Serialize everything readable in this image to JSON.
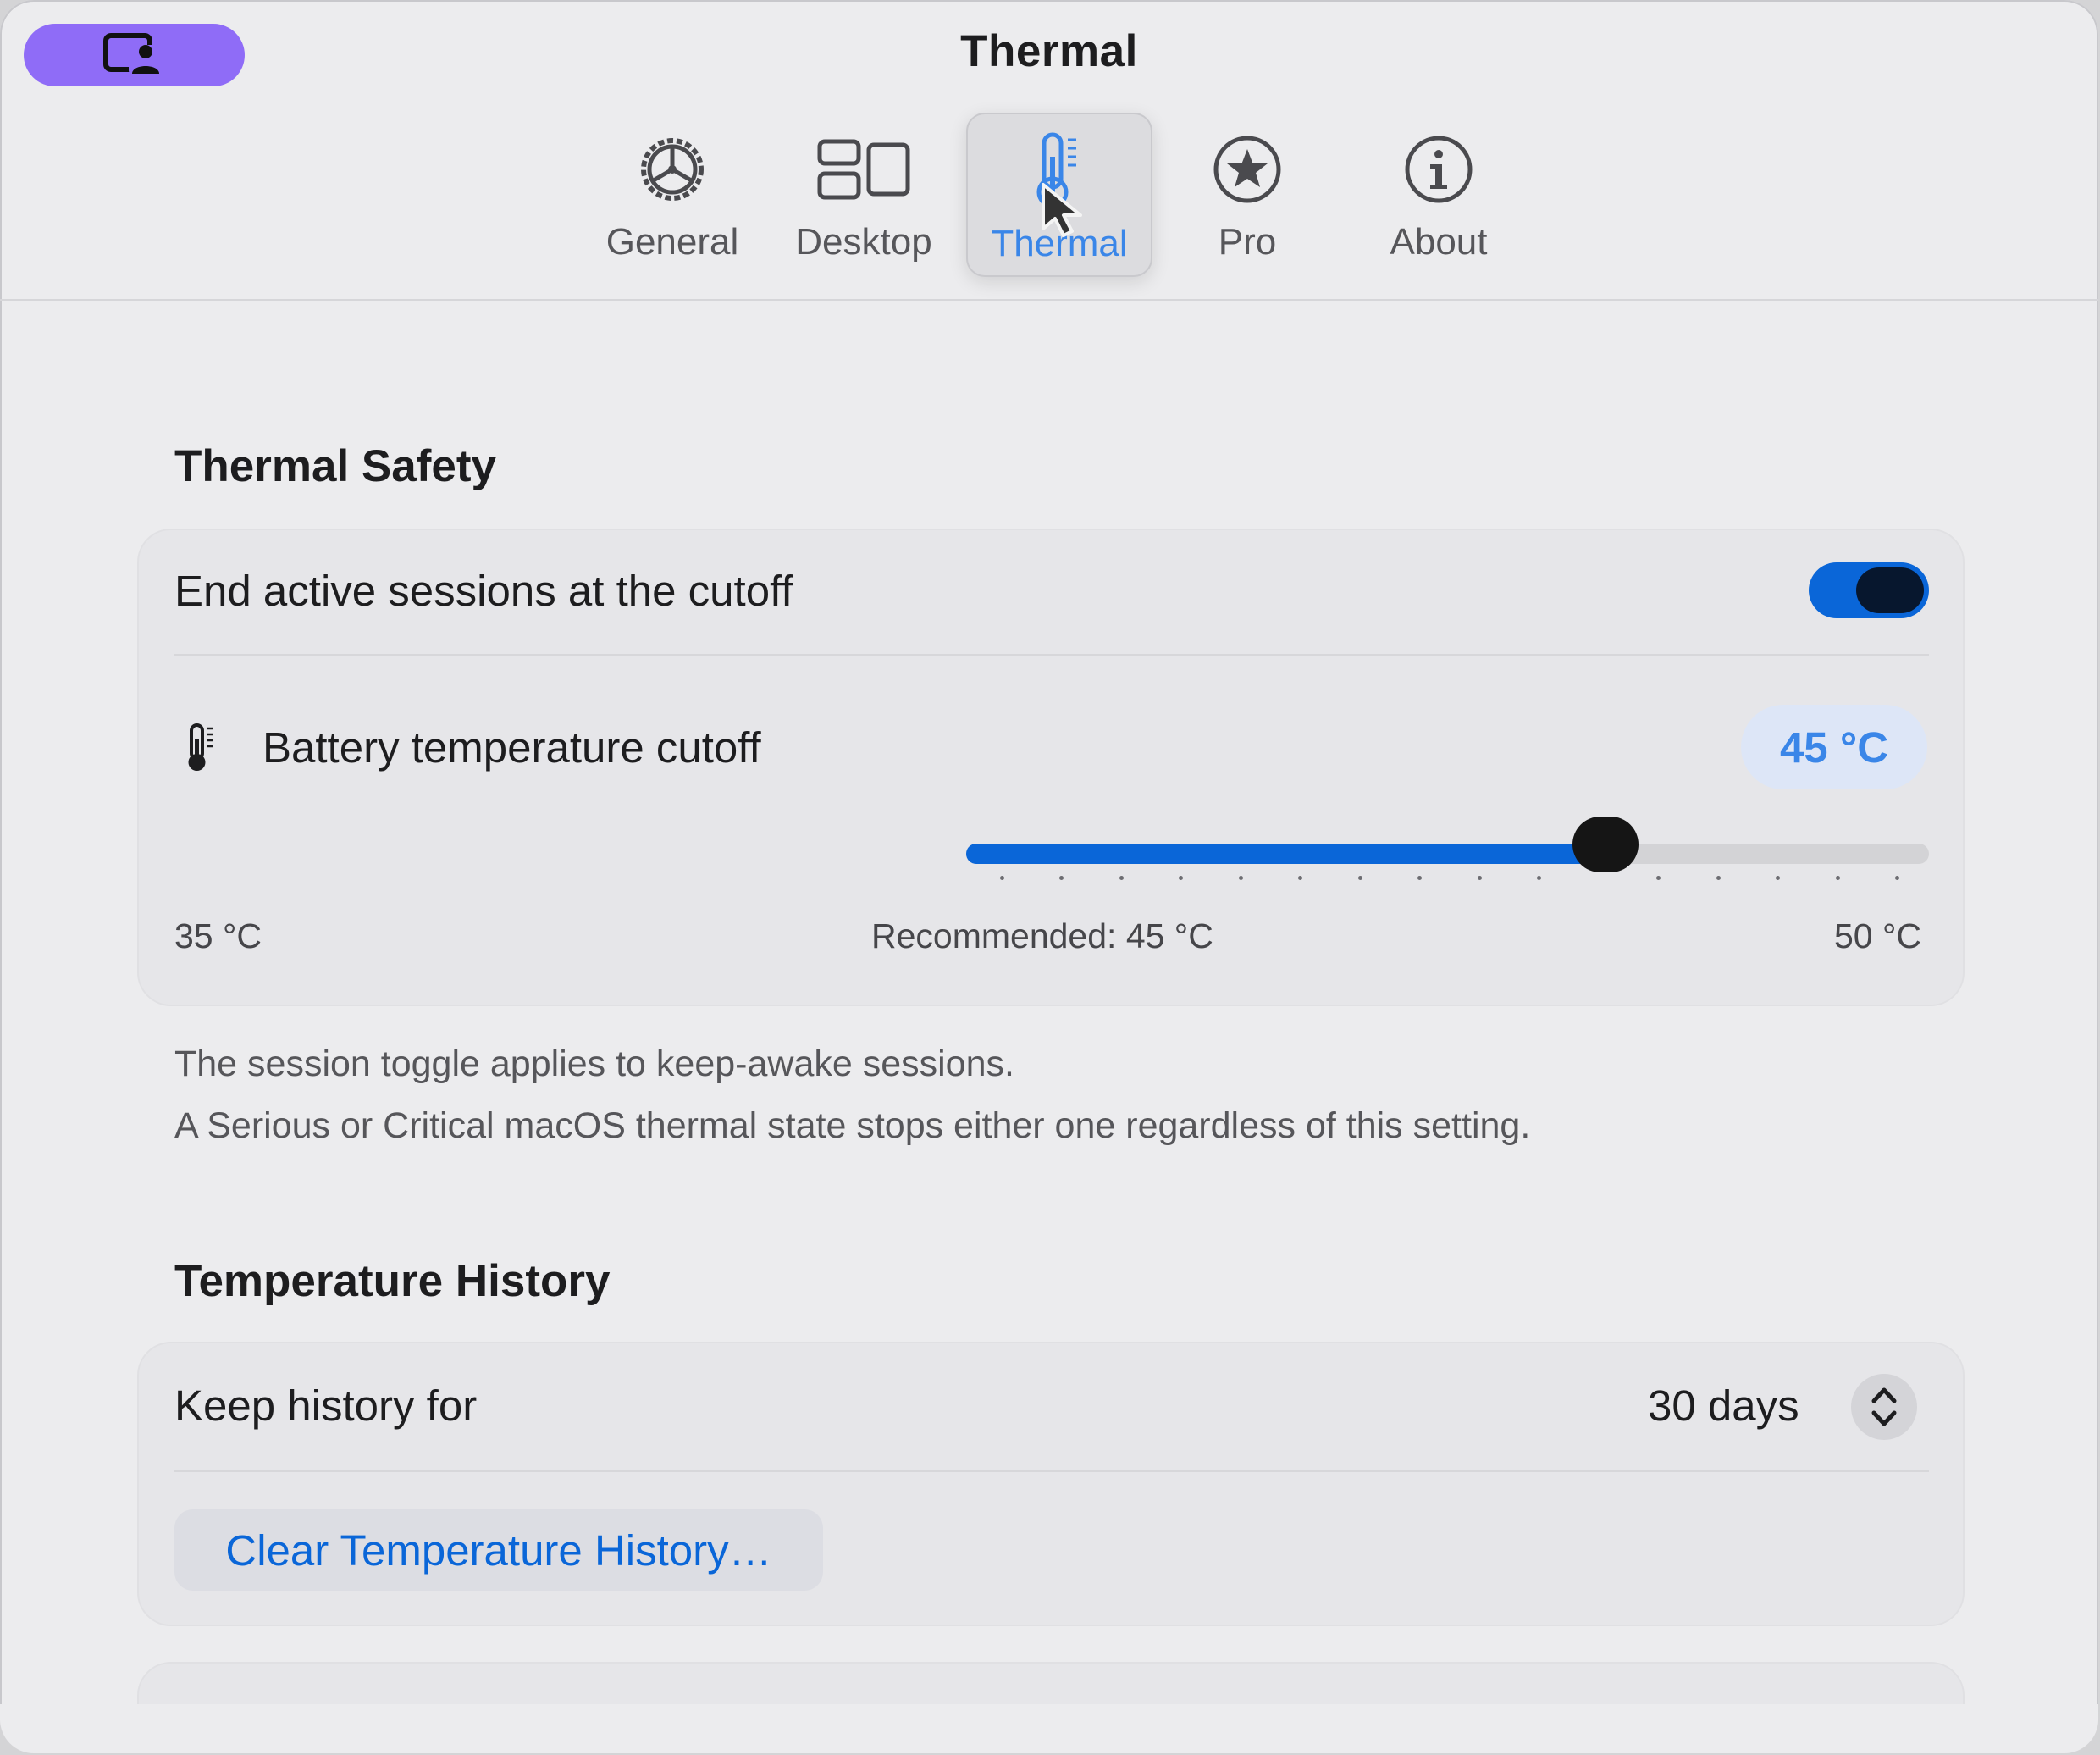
{
  "window": {
    "title": "Thermal"
  },
  "tabs": [
    {
      "label": "General",
      "icon": "gear-icon",
      "selected": false
    },
    {
      "label": "Desktop",
      "icon": "desktop-layout-icon",
      "selected": false
    },
    {
      "label": "Thermal",
      "icon": "thermometer-icon",
      "selected": true
    },
    {
      "label": "Pro",
      "icon": "star-circle-icon",
      "selected": false
    },
    {
      "label": "About",
      "icon": "info-circle-icon",
      "selected": false
    }
  ],
  "thermal_safety": {
    "title": "Thermal Safety",
    "end_sessions_label": "End active sessions at the cutoff",
    "end_sessions_enabled": true,
    "cutoff_label": "Battery temperature cutoff",
    "cutoff_value": "45 °C",
    "slider": {
      "min": 35,
      "max": 50,
      "value": 45,
      "step": 1
    },
    "min_label": "35 °C",
    "recommended_label": "Recommended: 45 °C",
    "max_label": "50 °C"
  },
  "notes": {
    "line1": "The session toggle applies to keep-awake sessions.",
    "line2": "A Serious or Critical macOS thermal state stops either one regardless of this setting."
  },
  "history": {
    "title": "Temperature History",
    "keep_label": "Keep history for",
    "keep_value": "30 days",
    "clear_button": "Clear Temperature History…"
  },
  "colors": {
    "accent": "#0a66d8",
    "accent_text": "#3a86e8",
    "badge": "#8f6cf7",
    "window_bg": "#ececee"
  }
}
